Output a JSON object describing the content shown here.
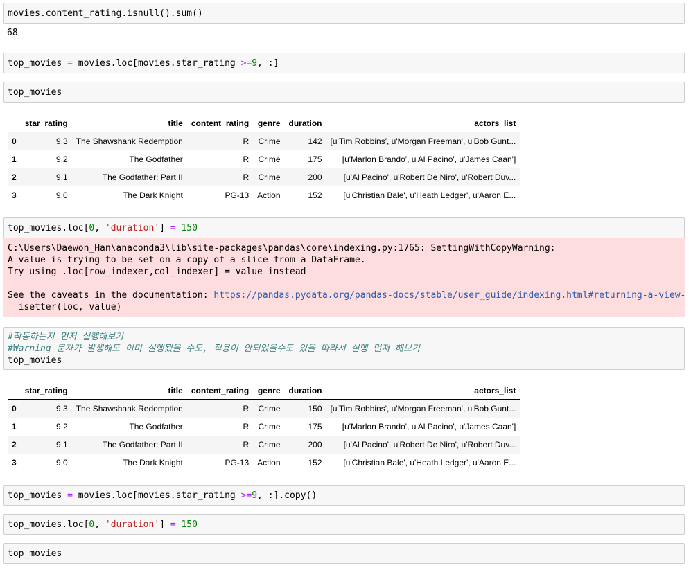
{
  "cells": {
    "c1": {
      "code": "movies.content_rating.isnull().sum()",
      "output": "68"
    },
    "c2": {
      "p1": "top_movies ",
      "op1": "=",
      "p2": " movies.loc[movies.star_rating ",
      "op2": ">=",
      "num": "9",
      "p3": ", :]"
    },
    "c3": {
      "code": "top_movies"
    },
    "c5": {
      "p1": "top_movies.loc[",
      "num1": "0",
      "p2": ", ",
      "str": "'duration'",
      "p3": "] ",
      "op": "=",
      "p4": " ",
      "num2": "150"
    },
    "c6": {
      "comment1": "#작동하는지 먼저 실행해보기",
      "comment2": "#Warning 문자가 발생해도 이미 실행됐을 수도, 적용이 안되었을수도 있을 따라서 실행 먼저 해보기",
      "code": "top_movies"
    },
    "c8": {
      "p1": "top_movies ",
      "op1": "=",
      "p2": " movies.loc[movies.star_rating ",
      "op2": ">=",
      "num": "9",
      "p3": ", :].copy()"
    },
    "c9": {
      "p1": "top_movies.loc[",
      "num1": "0",
      "p2": ", ",
      "str": "'duration'",
      "p3": "] ",
      "op": "=",
      "p4": " ",
      "num2": "150"
    },
    "c10": {
      "code": "top_movies"
    }
  },
  "warning": {
    "line1": "C:\\Users\\Daewon_Han\\anaconda3\\lib\\site-packages\\pandas\\core\\indexing.py:1765: SettingWithCopyWarning:",
    "line2": "A value is trying to be set on a copy of a slice from a DataFrame.",
    "line3": "Try using .loc[row_indexer,col_indexer] = value instead",
    "line4": "See the caveats in the documentation: ",
    "link": "https://pandas.pydata.org/pandas-docs/stable/user_guide/indexing.html#returning-a-view-versus-a-copy",
    "line5": "  isetter(loc, value)"
  },
  "table_headers": [
    "star_rating",
    "title",
    "content_rating",
    "genre",
    "duration",
    "actors_list"
  ],
  "table1": [
    [
      "0",
      "9.3",
      "The Shawshank Redemption",
      "R",
      "Crime",
      "142",
      "[u'Tim Robbins', u'Morgan Freeman', u'Bob Gunt..."
    ],
    [
      "1",
      "9.2",
      "The Godfather",
      "R",
      "Crime",
      "175",
      "[u'Marlon Brando', u'Al Pacino', u'James Caan']"
    ],
    [
      "2",
      "9.1",
      "The Godfather: Part II",
      "R",
      "Crime",
      "200",
      "[u'Al Pacino', u'Robert De Niro', u'Robert Duv..."
    ],
    [
      "3",
      "9.0",
      "The Dark Knight",
      "PG-13",
      "Action",
      "152",
      "[u'Christian Bale', u'Heath Ledger', u'Aaron E..."
    ]
  ],
  "table2": [
    [
      "0",
      "9.3",
      "The Shawshank Redemption",
      "R",
      "Crime",
      "150",
      "[u'Tim Robbins', u'Morgan Freeman', u'Bob Gunt..."
    ],
    [
      "1",
      "9.2",
      "The Godfather",
      "R",
      "Crime",
      "175",
      "[u'Marlon Brando', u'Al Pacino', u'James Caan']"
    ],
    [
      "2",
      "9.1",
      "The Godfather: Part II",
      "R",
      "Crime",
      "200",
      "[u'Al Pacino', u'Robert De Niro', u'Robert Duv..."
    ],
    [
      "3",
      "9.0",
      "The Dark Knight",
      "PG-13",
      "Action",
      "152",
      "[u'Christian Bale', u'Heath Ledger', u'Aaron E..."
    ]
  ]
}
